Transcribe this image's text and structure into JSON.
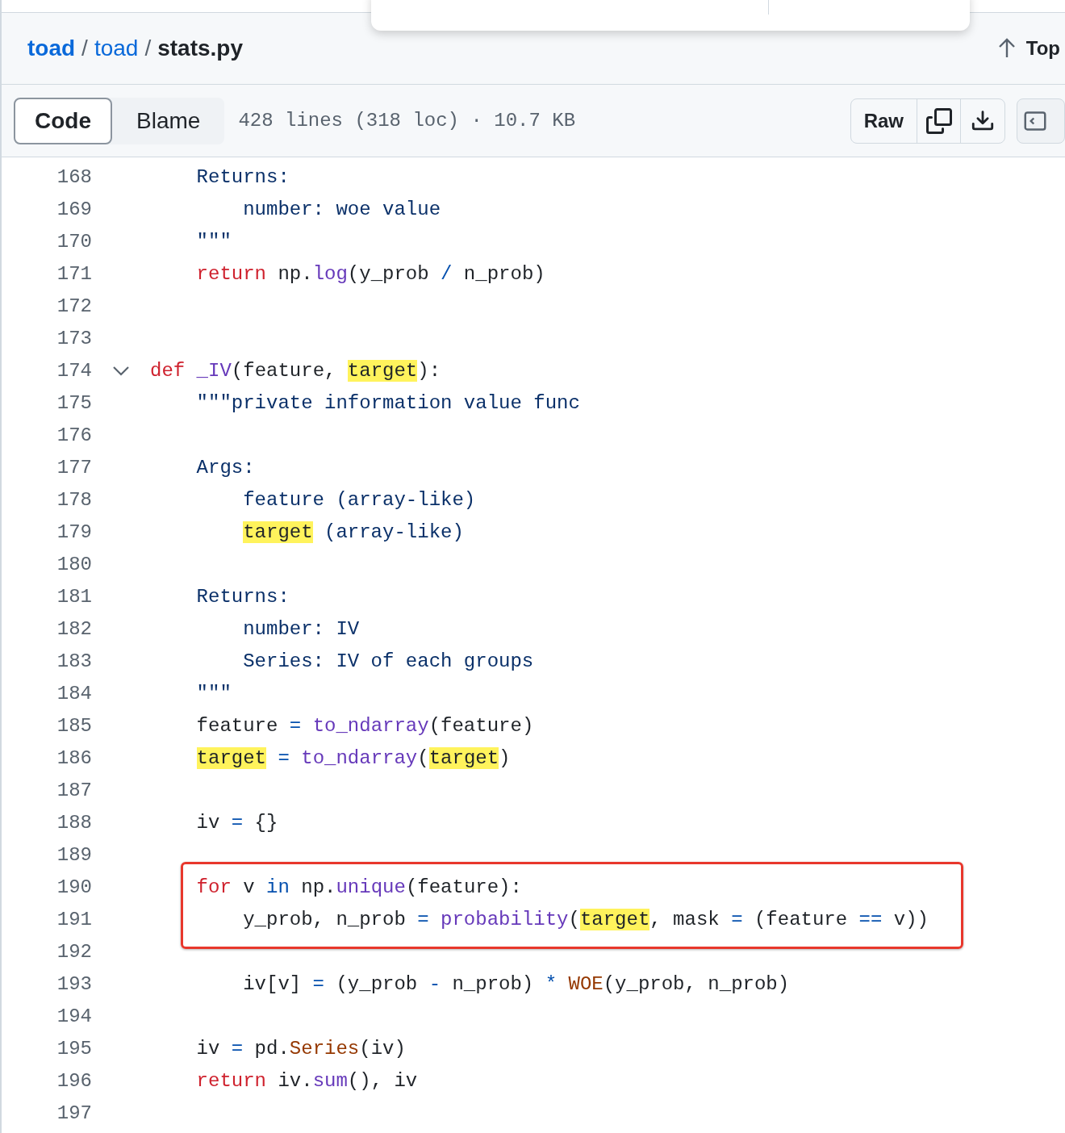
{
  "breadcrumb": {
    "separator": "/",
    "items": [
      {
        "kind": "repo",
        "text": "toad"
      },
      {
        "kind": "link",
        "text": "toad"
      },
      {
        "kind": "current",
        "text": "stats.py"
      }
    ]
  },
  "top_link": "Top",
  "view_tabs": [
    {
      "label": "Code",
      "selected": true
    },
    {
      "label": "Blame",
      "selected": false
    }
  ],
  "file_info": "428 lines (318 loc) · 10.7 KB",
  "actions": [
    {
      "kind": "text",
      "label": "Raw"
    },
    {
      "kind": "copy"
    },
    {
      "kind": "download"
    },
    {
      "kind": "symbols"
    }
  ],
  "lines": [
    {
      "kind": "continued",
      "children": [
        {
          "number": "168",
          "tokens": [
            {
              "kind": "doc",
              "text": "Returns:"
            }
          ],
          "children": [
            {
              "number": "169",
              "tokens": [
                {
                  "kind": "doc",
                  "text": "number: woe value"
                }
              ]
            }
          ]
        },
        {
          "number": "170",
          "tokens": [
            {
              "kind": "doc",
              "text": "\"\"\""
            }
          ]
        },
        {
          "number": "171",
          "tokens": [
            {
              "kind": "keyword",
              "text": "return"
            },
            {
              "kind": "plain",
              "text": " np."
            },
            {
              "kind": "func",
              "text": "log"
            },
            {
              "kind": "plain",
              "text": "(y_prob "
            },
            {
              "kind": "op",
              "text": "/"
            },
            {
              "kind": "plain",
              "text": " n_prob)"
            }
          ]
        }
      ]
    },
    {
      "number": "172"
    },
    {
      "number": "173"
    },
    {
      "number": "174",
      "expanded": true,
      "tokens": [
        {
          "kind": "keyword",
          "text": "def "
        },
        {
          "kind": "func",
          "text": "_IV"
        },
        {
          "kind": "plain",
          "text": "(feature, "
        },
        {
          "kind": "match",
          "text": "target"
        },
        {
          "kind": "plain",
          "text": "):"
        }
      ],
      "children": [
        {
          "number": "175",
          "tokens": [
            {
              "kind": "doc",
              "text": "\"\"\"private information value func"
            }
          ]
        },
        {
          "number": "176"
        },
        {
          "number": "177",
          "tokens": [
            {
              "kind": "doc",
              "text": "Args:"
            }
          ],
          "children": [
            {
              "number": "178",
              "tokens": [
                {
                  "kind": "doc",
                  "text": "feature (array-like)"
                }
              ]
            },
            {
              "number": "179",
              "tokens": [
                {
                  "kind": "match",
                  "text": "target"
                },
                {
                  "kind": "doc",
                  "text": " (array-like)"
                }
              ]
            }
          ]
        },
        {
          "number": "180"
        },
        {
          "number": "181",
          "tokens": [
            {
              "kind": "doc",
              "text": "Returns:"
            }
          ],
          "children": [
            {
              "number": "182",
              "tokens": [
                {
                  "kind": "doc",
                  "text": "number: IV"
                }
              ]
            },
            {
              "number": "183",
              "tokens": [
                {
                  "kind": "doc",
                  "text": "Series: IV of each groups"
                }
              ]
            }
          ]
        },
        {
          "number": "184",
          "tokens": [
            {
              "kind": "doc",
              "text": "\"\"\""
            }
          ]
        },
        {
          "number": "185",
          "tokens": [
            {
              "kind": "plain",
              "text": "feature "
            },
            {
              "kind": "op",
              "text": "= "
            },
            {
              "kind": "func",
              "text": "to_ndarray"
            },
            {
              "kind": "plain",
              "text": "(feature)"
            }
          ]
        },
        {
          "number": "186",
          "tokens": [
            {
              "kind": "match",
              "text": "target"
            },
            {
              "kind": "op",
              "text": " = "
            },
            {
              "kind": "func",
              "text": "to_ndarray"
            },
            {
              "kind": "plain",
              "text": "("
            },
            {
              "kind": "match",
              "text": "target"
            },
            {
              "kind": "plain",
              "text": ")"
            }
          ]
        },
        {
          "number": "187"
        },
        {
          "number": "188",
          "tokens": [
            {
              "kind": "plain",
              "text": "iv "
            },
            {
              "kind": "op",
              "text": "="
            },
            {
              "kind": "plain",
              "text": " {}"
            }
          ]
        },
        {
          "number": "189"
        },
        {
          "number": "190",
          "boxed": true,
          "tokens": [
            {
              "kind": "keyword",
              "text": "for"
            },
            {
              "kind": "plain",
              "text": " v "
            },
            {
              "kind": "op",
              "text": "in"
            },
            {
              "kind": "plain",
              "text": " np."
            },
            {
              "kind": "func",
              "text": "unique"
            },
            {
              "kind": "plain",
              "text": "(feature):"
            }
          ],
          "children": [
            {
              "number": "191",
              "boxed": true,
              "tokens": [
                {
                  "kind": "plain",
                  "text": "y_prob, n_prob "
                },
                {
                  "kind": "op",
                  "text": "= "
                },
                {
                  "kind": "func",
                  "text": "probability"
                },
                {
                  "kind": "plain",
                  "text": "("
                },
                {
                  "kind": "match",
                  "text": "target"
                },
                {
                  "kind": "plain",
                  "text": ", mask "
                },
                {
                  "kind": "op",
                  "text": "="
                },
                {
                  "kind": "plain",
                  "text": " (feature "
                },
                {
                  "kind": "op",
                  "text": "=="
                },
                {
                  "kind": "plain",
                  "text": " v))"
                }
              ]
            },
            {
              "number": "192"
            },
            {
              "number": "193",
              "tokens": [
                {
                  "kind": "plain",
                  "text": "iv[v] "
                },
                {
                  "kind": "op",
                  "text": "="
                },
                {
                  "kind": "plain",
                  "text": " (y_prob "
                },
                {
                  "kind": "op",
                  "text": "-"
                },
                {
                  "kind": "plain",
                  "text": " n_prob) "
                },
                {
                  "kind": "op",
                  "text": "* "
                },
                {
                  "kind": "class",
                  "text": "WOE"
                },
                {
                  "kind": "plain",
                  "text": "(y_prob, n_prob)"
                }
              ]
            }
          ]
        },
        {
          "number": "194"
        },
        {
          "number": "195",
          "tokens": [
            {
              "kind": "plain",
              "text": "iv "
            },
            {
              "kind": "op",
              "text": "="
            },
            {
              "kind": "plain",
              "text": " pd."
            },
            {
              "kind": "class",
              "text": "Series"
            },
            {
              "kind": "plain",
              "text": "(iv)"
            }
          ]
        },
        {
          "number": "196",
          "tokens": [
            {
              "kind": "keyword",
              "text": "return"
            },
            {
              "kind": "plain",
              "text": " iv."
            },
            {
              "kind": "func",
              "text": "sum"
            },
            {
              "kind": "plain",
              "text": "(), iv"
            }
          ]
        },
        {
          "number": "197"
        }
      ]
    }
  ]
}
